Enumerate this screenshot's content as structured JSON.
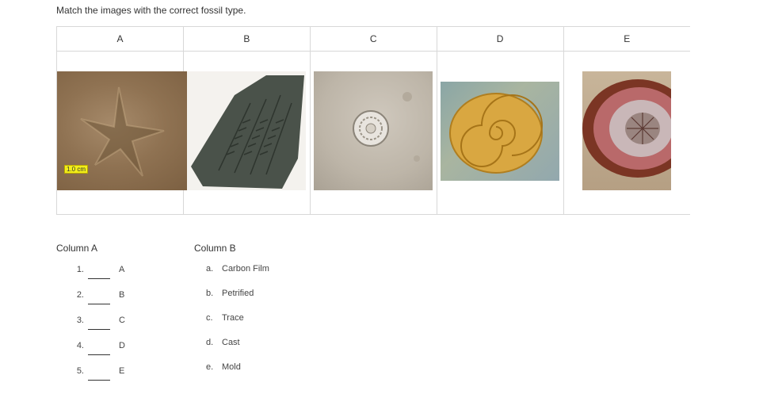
{
  "instructions": "Match the images with the correct fossil type.",
  "table": {
    "headers": [
      "A",
      "B",
      "C",
      "D",
      "E"
    ],
    "images": [
      {
        "icon": "starfish-trace-fossil",
        "scale_label": "1.0 cm"
      },
      {
        "icon": "fern-carbon-film-fossil"
      },
      {
        "icon": "round-cast-fossil"
      },
      {
        "icon": "ammonite-mold-fossil"
      },
      {
        "icon": "petrified-wood-fossil"
      }
    ]
  },
  "column_a": {
    "title": "Column A",
    "rows": [
      {
        "number": "1.",
        "answer": "",
        "letter": "A"
      },
      {
        "number": "2.",
        "answer": "",
        "letter": "B"
      },
      {
        "number": "3.",
        "answer": "",
        "letter": "C"
      },
      {
        "number": "4.",
        "answer": "",
        "letter": "D"
      },
      {
        "number": "5.",
        "answer": "",
        "letter": "E"
      }
    ]
  },
  "column_b": {
    "title": "Column B",
    "options": [
      {
        "letter": "a.",
        "text": "Carbon Film"
      },
      {
        "letter": "b.",
        "text": "Petrified"
      },
      {
        "letter": "c.",
        "text": "Trace"
      },
      {
        "letter": "d.",
        "text": "Cast"
      },
      {
        "letter": "e.",
        "text": "Mold"
      }
    ]
  }
}
